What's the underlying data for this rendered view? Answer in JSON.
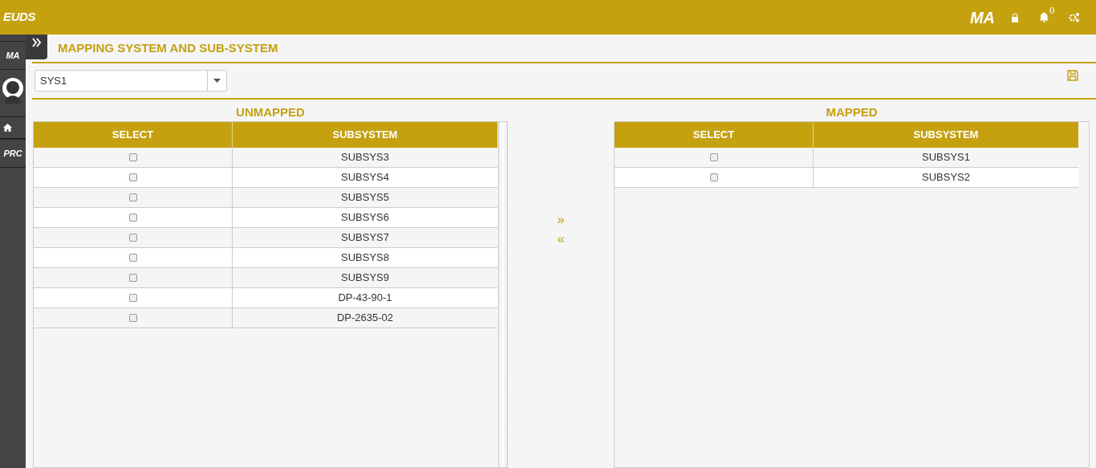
{
  "header": {
    "logo": "EUDS",
    "app_logo": "MA",
    "notification_count": "0"
  },
  "sidebar": {
    "items": [
      {
        "kind": "logo",
        "label": "MA"
      },
      {
        "kind": "avatar"
      },
      {
        "kind": "home"
      },
      {
        "kind": "logo",
        "label": "PRC"
      }
    ]
  },
  "page": {
    "title": "MAPPING SYSTEM AND SUB-SYSTEM",
    "system_select": {
      "value": "SYS1"
    }
  },
  "unmapped": {
    "title": "UNMAPPED",
    "columns": [
      "SELECT",
      "SUBSYSTEM"
    ],
    "rows": [
      {
        "checked": false,
        "subsystem": "SUBSYS3"
      },
      {
        "checked": false,
        "subsystem": "SUBSYS4"
      },
      {
        "checked": false,
        "subsystem": "SUBSYS5"
      },
      {
        "checked": false,
        "subsystem": "SUBSYS6"
      },
      {
        "checked": false,
        "subsystem": "SUBSYS7"
      },
      {
        "checked": false,
        "subsystem": "SUBSYS8"
      },
      {
        "checked": false,
        "subsystem": "SUBSYS9"
      },
      {
        "checked": false,
        "subsystem": "DP-43-90-1"
      },
      {
        "checked": false,
        "subsystem": "DP-2635-02"
      }
    ]
  },
  "transfer_buttons": [
    "»",
    "«"
  ],
  "mapped": {
    "title": "MAPPED",
    "columns": [
      "SELECT",
      "SUBSYSTEM"
    ],
    "rows": [
      {
        "checked": false,
        "subsystem": "SUBSYS1"
      },
      {
        "checked": false,
        "subsystem": "SUBSYS2"
      }
    ]
  }
}
